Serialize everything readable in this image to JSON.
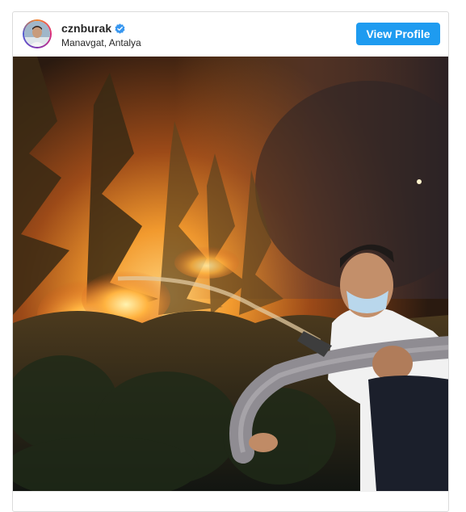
{
  "post": {
    "username": "cznburak",
    "verified": true,
    "location": "Manavgat, Antalya",
    "view_profile_label": "View Profile",
    "photo_subject": "night-forest-fire-firefighting"
  },
  "icons": {
    "verified": "verified-badge-icon"
  },
  "colors": {
    "accent": "#1e9bf0",
    "verified_badge": "#3897f0",
    "border": "#dbdbdb",
    "text": "#262626"
  }
}
